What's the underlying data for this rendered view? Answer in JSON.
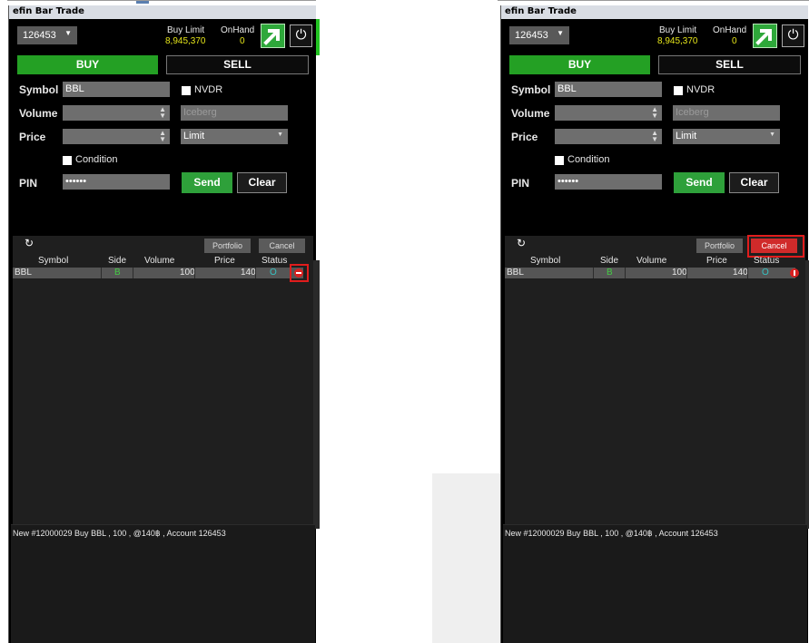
{
  "app_title": "efin Bar Trade",
  "account": "126453",
  "buy_limit_label": "Buy Limit",
  "buy_limit_value": "8,945,370",
  "onhand_label": "OnHand",
  "onhand_value": "0",
  "tabs": {
    "buy": "BUY",
    "sell": "SELL"
  },
  "form": {
    "symbol_label": "Symbol",
    "symbol_value": "BBL",
    "nvdr_label": "NVDR",
    "volume_label": "Volume",
    "iceberg_placeholder": "Iceberg",
    "price_label": "Price",
    "price_type": "Limit",
    "condition_label": "Condition",
    "pin_label": "PIN",
    "pin_value": "••••••",
    "send_label": "Send",
    "clear_label": "Clear"
  },
  "orders": {
    "portfolio_label": "Portfolio",
    "cancel_label": "Cancel",
    "columns": [
      "Symbol",
      "Side",
      "Volume",
      "Price",
      "Status"
    ],
    "rows": [
      {
        "symbol": "BBL",
        "side": "B",
        "volume": "100",
        "price": "140",
        "status": "O"
      }
    ]
  },
  "message": "New #12000029 Buy BBL , 100 , @140฿ , Account 126453",
  "icons": [
    "refresh-icon",
    "power-icon",
    "arrow-up-right-icon",
    "delete-order-icon"
  ],
  "colors": {
    "buy_green": "#24a024",
    "cancel_red": "#d02a2a",
    "highlight": "#e01c1c",
    "value_yellow": "#e5e51a"
  }
}
